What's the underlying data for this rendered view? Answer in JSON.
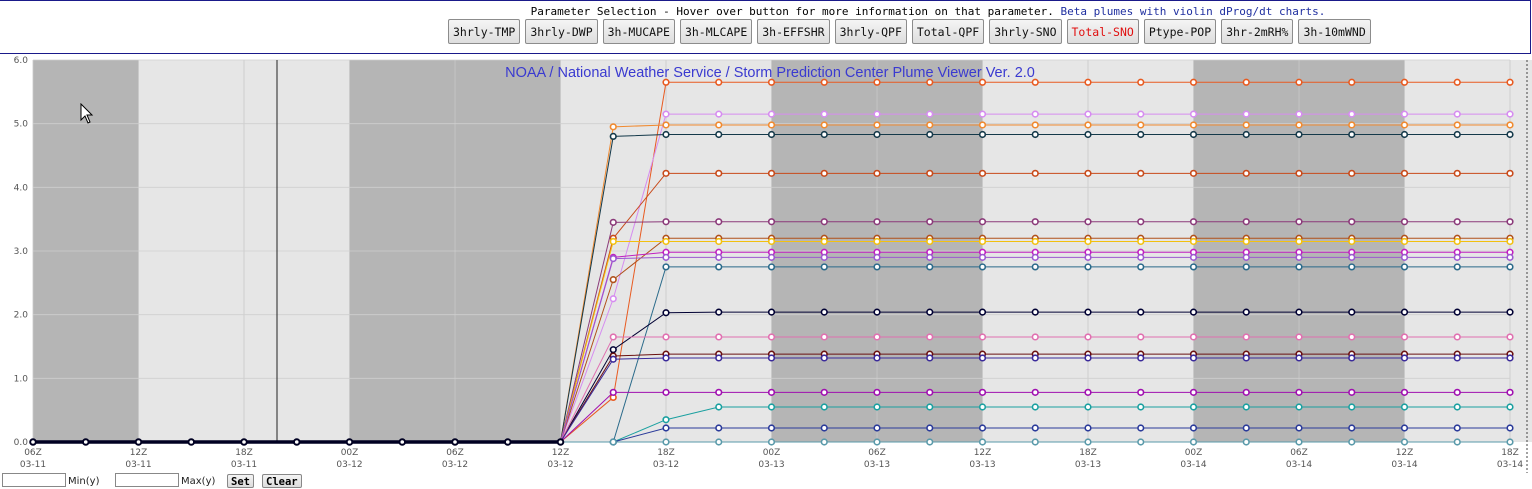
{
  "toolbar": {
    "caption": "Parameter Selection - Hover over button for more information on that parameter.",
    "beta_link": "Beta plumes with violin dProg/dt charts.",
    "buttons": [
      {
        "label": "3hrly-TMP"
      },
      {
        "label": "3hrly-DWP"
      },
      {
        "label": "3h-MUCAPE"
      },
      {
        "label": "3h-MLCAPE"
      },
      {
        "label": "3h-EFFSHR"
      },
      {
        "label": "3hrly-QPF"
      },
      {
        "label": "Total-QPF"
      },
      {
        "label": "3hrly-SNO"
      },
      {
        "label": "Total-SNO",
        "active": true
      },
      {
        "label": "Ptype-POP"
      },
      {
        "label": "3hr-2mRH%"
      },
      {
        "label": "3h-10mWND"
      }
    ]
  },
  "bottom": {
    "min_label": "Min(y)",
    "max_label": "Max(y)",
    "set_label": "Set",
    "clear_label": "Clear"
  },
  "chart_data": {
    "type": "line",
    "title": "NOAA / National Weather Service / Storm Prediction Center Plume Viewer Ver. 2.0",
    "x_ticks": [
      {
        "hour": "06Z",
        "date": "03-11"
      },
      {
        "hour": "12Z",
        "date": "03-11"
      },
      {
        "hour": "18Z",
        "date": "03-11"
      },
      {
        "hour": "00Z",
        "date": "03-12"
      },
      {
        "hour": "06Z",
        "date": "03-12"
      },
      {
        "hour": "12Z",
        "date": "03-12"
      },
      {
        "hour": "18Z",
        "date": "03-12"
      },
      {
        "hour": "00Z",
        "date": "03-13"
      },
      {
        "hour": "06Z",
        "date": "03-13"
      },
      {
        "hour": "12Z",
        "date": "03-13"
      },
      {
        "hour": "18Z",
        "date": "03-13"
      },
      {
        "hour": "00Z",
        "date": "03-14"
      },
      {
        "hour": "06Z",
        "date": "03-14"
      },
      {
        "hour": "12Z",
        "date": "03-14"
      },
      {
        "hour": "18Z",
        "date": "03-14"
      }
    ],
    "y_ticks": [
      "0.0",
      "1.0",
      "2.0",
      "3.0",
      "4.0",
      "5.0",
      "6.0"
    ],
    "ylim": [
      0,
      6
    ],
    "x_hours_range": [
      0,
      84
    ],
    "night_shading": [
      [
        0,
        6
      ],
      [
        18,
        30
      ],
      [
        42,
        54
      ],
      [
        66,
        78
      ]
    ],
    "grid": true,
    "x_hours": [
      0,
      3,
      6,
      9,
      12,
      15,
      18,
      21,
      24,
      27,
      30,
      33,
      36,
      39,
      42,
      45,
      48,
      51,
      54,
      57,
      60,
      63,
      66,
      69,
      72,
      75,
      78,
      81,
      84
    ],
    "series": [
      {
        "color": "#e85a20",
        "values": [
          0,
          0,
          0,
          0,
          0,
          0,
          0,
          0,
          0,
          0,
          0,
          0.7,
          5.65,
          5.65,
          5.65,
          5.65,
          5.65,
          5.65,
          5.65,
          5.65,
          5.65,
          5.65,
          5.65,
          5.65,
          5.65,
          5.65,
          5.65,
          5.65,
          5.65
        ]
      },
      {
        "color": "#d68cf0",
        "values": [
          0,
          0,
          0,
          0,
          0,
          0,
          0,
          0,
          0,
          0,
          0,
          2.25,
          5.15,
          5.15,
          5.15,
          5.15,
          5.15,
          5.15,
          5.15,
          5.15,
          5.15,
          5.15,
          5.15,
          5.15,
          5.15,
          5.15,
          5.15,
          5.15,
          5.15
        ]
      },
      {
        "color": "#f08a30",
        "values": [
          0,
          0,
          0,
          0,
          0,
          0,
          0,
          0,
          0,
          0,
          0,
          4.95,
          4.98,
          4.98,
          4.98,
          4.98,
          4.98,
          4.98,
          4.98,
          4.98,
          4.98,
          4.98,
          4.98,
          4.98,
          4.98,
          4.98,
          4.98,
          4.98,
          4.98
        ]
      },
      {
        "color": "#14394a",
        "values": [
          0,
          0,
          0,
          0,
          0,
          0,
          0,
          0,
          0,
          0,
          0,
          4.8,
          4.83,
          4.83,
          4.83,
          4.83,
          4.83,
          4.83,
          4.83,
          4.83,
          4.83,
          4.83,
          4.83,
          4.83,
          4.83,
          4.83,
          4.83,
          4.83,
          4.83
        ]
      },
      {
        "color": "#c84a1a",
        "values": [
          0,
          0,
          0,
          0,
          0,
          0,
          0,
          0,
          0,
          0,
          0,
          3.2,
          4.22,
          4.22,
          4.22,
          4.22,
          4.22,
          4.22,
          4.22,
          4.22,
          4.22,
          4.22,
          4.22,
          4.22,
          4.22,
          4.22,
          4.22,
          4.22,
          4.22
        ]
      },
      {
        "color": "#8b3a7a",
        "values": [
          0,
          0,
          0,
          0,
          0,
          0,
          0,
          0,
          0,
          0,
          0,
          3.45,
          3.46,
          3.46,
          3.46,
          3.46,
          3.46,
          3.46,
          3.46,
          3.46,
          3.46,
          3.46,
          3.46,
          3.46,
          3.46,
          3.46,
          3.46,
          3.46,
          3.46
        ]
      },
      {
        "color": "#b0501a",
        "values": [
          0,
          0,
          0,
          0,
          0,
          0,
          0,
          0,
          0,
          0,
          0,
          2.55,
          3.2,
          3.2,
          3.2,
          3.2,
          3.2,
          3.2,
          3.2,
          3.2,
          3.2,
          3.2,
          3.2,
          3.2,
          3.2,
          3.2,
          3.2,
          3.2,
          3.2
        ]
      },
      {
        "color": "#f2c010",
        "values": [
          0,
          0,
          0,
          0,
          0,
          0,
          0,
          0,
          0,
          0,
          0,
          3.15,
          3.15,
          3.15,
          3.15,
          3.15,
          3.15,
          3.15,
          3.15,
          3.15,
          3.15,
          3.15,
          3.15,
          3.15,
          3.15,
          3.15,
          3.15,
          3.15,
          3.15
        ]
      },
      {
        "color": "#c020c0",
        "values": [
          0,
          0,
          0,
          0,
          0,
          0,
          0,
          0,
          0,
          0,
          0,
          2.9,
          2.98,
          2.98,
          2.98,
          2.98,
          2.98,
          2.98,
          2.98,
          2.98,
          2.98,
          2.98,
          2.98,
          2.98,
          2.98,
          2.98,
          2.98,
          2.98,
          2.98
        ]
      },
      {
        "color": "#9b59d0",
        "values": [
          0,
          0,
          0,
          0,
          0,
          0,
          0,
          0,
          0,
          0,
          0,
          2.88,
          2.9,
          2.9,
          2.9,
          2.9,
          2.9,
          2.9,
          2.9,
          2.9,
          2.9,
          2.9,
          2.9,
          2.9,
          2.9,
          2.9,
          2.9,
          2.9,
          2.9
        ]
      },
      {
        "color": "#2a6a8a",
        "values": [
          0,
          0,
          0,
          0,
          0,
          0,
          0,
          0,
          0,
          0,
          0,
          0,
          2.75,
          2.75,
          2.75,
          2.75,
          2.75,
          2.75,
          2.75,
          2.75,
          2.75,
          2.75,
          2.75,
          2.75,
          2.75,
          2.75,
          2.75,
          2.75,
          2.75
        ]
      },
      {
        "color": "#000033",
        "values": [
          0,
          0,
          0,
          0,
          0,
          0,
          0,
          0,
          0,
          0,
          0,
          1.45,
          2.03,
          2.04,
          2.04,
          2.04,
          2.04,
          2.04,
          2.04,
          2.04,
          2.04,
          2.04,
          2.04,
          2.04,
          2.04,
          2.04,
          2.04,
          2.04,
          2.04
        ]
      },
      {
        "color": "#e070b0",
        "values": [
          0,
          0,
          0,
          0,
          0,
          0,
          0,
          0,
          0,
          0,
          0,
          1.65,
          1.65,
          1.65,
          1.65,
          1.65,
          1.65,
          1.65,
          1.65,
          1.65,
          1.65,
          1.65,
          1.65,
          1.65,
          1.65,
          1.65,
          1.65,
          1.65,
          1.65
        ]
      },
      {
        "color": "#6a1010",
        "values": [
          0,
          0,
          0,
          0,
          0,
          0,
          0,
          0,
          0,
          0,
          0,
          1.35,
          1.38,
          1.38,
          1.38,
          1.38,
          1.38,
          1.38,
          1.38,
          1.38,
          1.38,
          1.38,
          1.38,
          1.38,
          1.38,
          1.38,
          1.38,
          1.38,
          1.38
        ]
      },
      {
        "color": "#3a2a9a",
        "values": [
          0,
          0,
          0,
          0,
          0,
          0,
          0,
          0,
          0,
          0,
          0,
          1.3,
          1.32,
          1.32,
          1.32,
          1.32,
          1.32,
          1.32,
          1.32,
          1.32,
          1.32,
          1.32,
          1.32,
          1.32,
          1.32,
          1.32,
          1.32,
          1.32,
          1.32
        ]
      },
      {
        "color": "#a010b0",
        "values": [
          0,
          0,
          0,
          0,
          0,
          0,
          0,
          0,
          0,
          0,
          0,
          0.78,
          0.78,
          0.78,
          0.78,
          0.78,
          0.78,
          0.78,
          0.78,
          0.78,
          0.78,
          0.78,
          0.78,
          0.78,
          0.78,
          0.78,
          0.78,
          0.78,
          0.78
        ]
      },
      {
        "color": "#1aa0a0",
        "values": [
          0,
          0,
          0,
          0,
          0,
          0,
          0,
          0,
          0,
          0,
          0,
          0,
          0.35,
          0.55,
          0.55,
          0.55,
          0.55,
          0.55,
          0.55,
          0.55,
          0.55,
          0.55,
          0.55,
          0.55,
          0.55,
          0.55,
          0.55,
          0.55,
          0.55
        ]
      },
      {
        "color": "#2a3a9a",
        "values": [
          0,
          0,
          0,
          0,
          0,
          0,
          0,
          0,
          0,
          0,
          0,
          0,
          0.22,
          0.22,
          0.22,
          0.22,
          0.22,
          0.22,
          0.22,
          0.22,
          0.22,
          0.22,
          0.22,
          0.22,
          0.22,
          0.22,
          0.22,
          0.22,
          0.22
        ]
      },
      {
        "color": "#5a9aaa",
        "values": [
          0,
          0,
          0,
          0,
          0,
          0,
          0,
          0,
          0,
          0,
          0,
          0,
          0,
          0,
          0,
          0,
          0,
          0,
          0,
          0,
          0,
          0,
          0,
          0,
          0,
          0,
          0,
          0,
          0
        ]
      }
    ],
    "mean_series_color": "#000022"
  }
}
